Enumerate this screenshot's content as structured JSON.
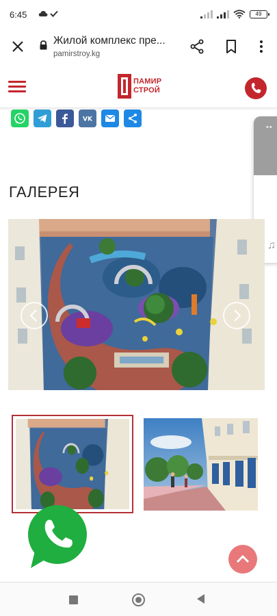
{
  "status_bar": {
    "time": "6:45",
    "battery": "49"
  },
  "browser": {
    "title": "Жилой комплекс пре...",
    "url": "pamirstroy.kg"
  },
  "site": {
    "logo_line1": "ПАМИР",
    "logo_line2": "СТРОЙ",
    "brand_color": "#c3262d"
  },
  "social": {
    "items": [
      "whatsapp-icon",
      "telegram-icon",
      "facebook-icon",
      "vk-icon",
      "email-icon",
      "share-icon"
    ]
  },
  "gallery": {
    "heading": "ГАЛЕРЕЯ",
    "main_image": "courtyard-playground-aerial-render",
    "thumbnails": [
      "courtyard-playground-aerial-render",
      "building-street-promenade-render"
    ],
    "selected_thumbnail": 1
  }
}
